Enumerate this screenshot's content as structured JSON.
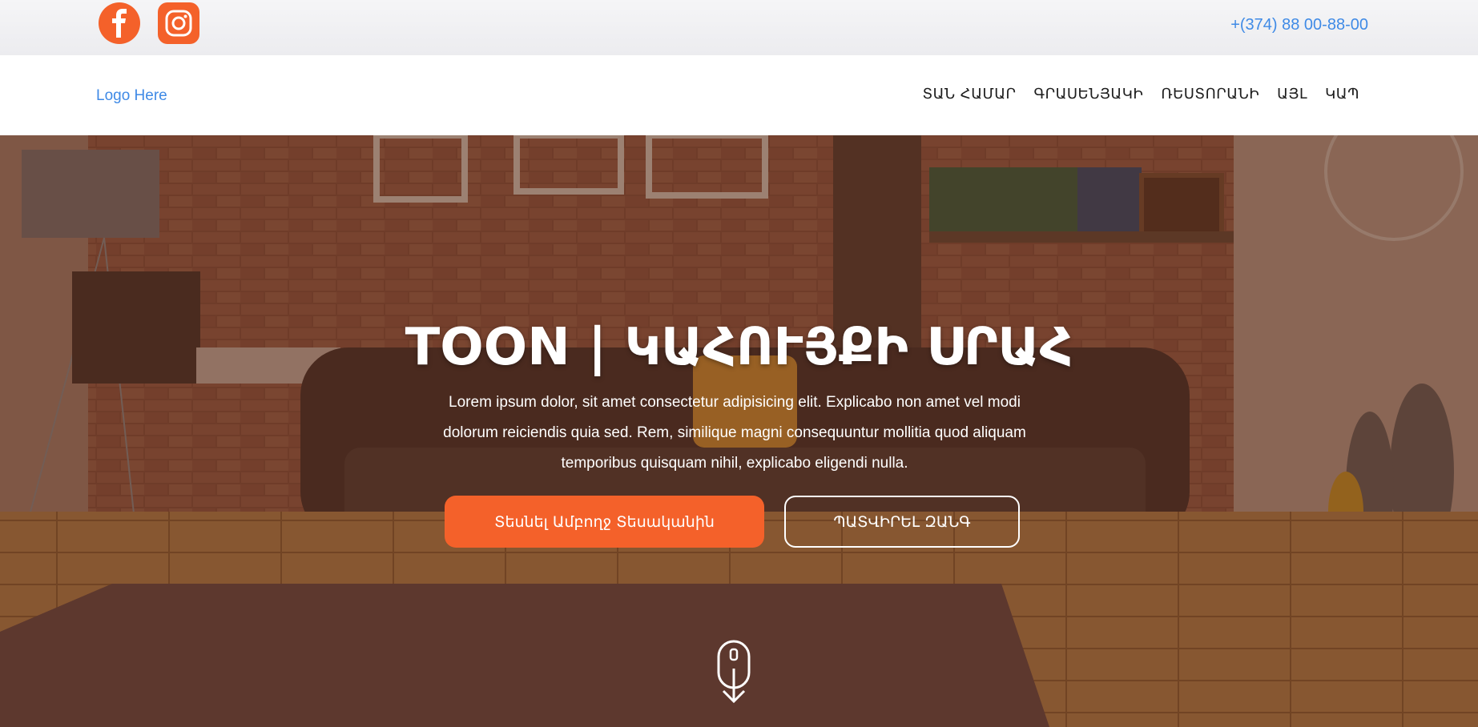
{
  "topbar": {
    "social": [
      {
        "name": "facebook-icon"
      },
      {
        "name": "instagram-icon"
      }
    ],
    "phone": "+(374) 88 00-88-00"
  },
  "nav": {
    "logo": "Logo Here",
    "items": [
      "ՏԱՆ ՀԱՄԱՐ",
      "ԳՐԱՍԵՆՅԱԿԻ",
      "ՌԵՍՏՈՐԱՆԻ",
      "ԱՅԼ",
      "ԿԱՊ"
    ]
  },
  "hero": {
    "title": "TOON | ԿԱՀՈՒՅՔԻ ՍՐԱՀ",
    "text": "Lorem ipsum dolor, sit amet consectetur adipisicing elit. Explicabo non amet vel modi dolorum reiciendis quia sed. Rem, similique magni consequuntur mollitia quod aliquam temporibus quisquam nihil, explicabo eligendi nulla.",
    "primary_button": "Տեսնել Ամբողջ Տեսականին",
    "secondary_button": "ՊԱՏՎԻՐԵԼ ԶԱՆԳ"
  },
  "colors": {
    "accent": "#f4612a",
    "link": "#3f8ae6",
    "overlay": "#4a2616"
  }
}
